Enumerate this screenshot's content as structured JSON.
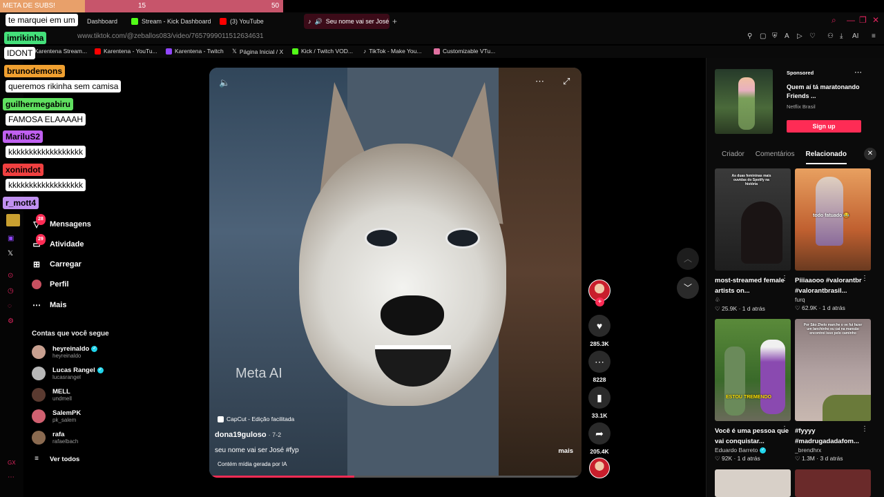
{
  "subgoal": {
    "label": "META DE SUBS!",
    "current": "15",
    "target": "50",
    "progress": 0.3
  },
  "tabs": [
    {
      "label": "Dashboard",
      "color": "#53fc18"
    },
    {
      "label": "Stream - Kick Dashboard",
      "color": "#53fc18"
    },
    {
      "label": "(3) YouTube",
      "color": "#ff0000"
    },
    {
      "label": "Seu nome vai ser José",
      "color": "#fe2c55"
    }
  ],
  "url": "www.tiktok.com/@zeballos083/video/7657999011512634631",
  "bookmarks": [
    {
      "label": "Karentena Stream..."
    },
    {
      "label": "Karentena - YouTu..."
    },
    {
      "label": "Karentena - Twitch"
    },
    {
      "label": "Página Inicial / X"
    },
    {
      "label": "Kick / Twitch VOD..."
    },
    {
      "label": "TikTok - Make You..."
    },
    {
      "label": "Customizable VTu..."
    }
  ],
  "chat": [
    {
      "user": "",
      "msg": "te marquei em um"
    },
    {
      "user": "imrikinha",
      "msg": "IDONT"
    },
    {
      "user": "brunodemons",
      "msg": "queremos rikinha sem camisa"
    },
    {
      "user": "guilhermegabiru",
      "msg": "FAMOSA ELAAAAH"
    },
    {
      "user": "MariluS2",
      "msg": "kkkkkkkkkkkkkkkkkk"
    },
    {
      "user": "xonindot",
      "msg": "kkkkkkkkkkkkkkkkkk"
    },
    {
      "user": "r_mott4",
      "msg": ""
    }
  ],
  "nav": {
    "messages": "Mensagens",
    "messages_badge": "28",
    "activity": "Atividade",
    "activity_badge": "29",
    "upload": "Carregar",
    "profile": "Perfil",
    "more": "Mais"
  },
  "following_title": "Contas que você segue",
  "following": [
    {
      "name": "heyreinaldo",
      "handle": "heyreinaldo",
      "verified": true
    },
    {
      "name": "Lucas Rangel",
      "handle": "lucasrangel",
      "verified": true
    },
    {
      "name": "MELL",
      "handle": "undmell",
      "verified": false
    },
    {
      "name": "SalemPK",
      "handle": "pk_salem",
      "verified": false
    },
    {
      "name": "rafa",
      "handle": "rafaelbach",
      "verified": false
    }
  ],
  "see_all": "Ver todos",
  "video": {
    "watermark": "Meta AI",
    "capcut": "CapCut - Edição facilitada",
    "author": "dona19guloso",
    "date": "· 7-2",
    "description": "seu nome vai ser José #fyp",
    "more": "mais",
    "ai_label": "Contém mídia gerada por IA",
    "progress": 0.39
  },
  "actions": {
    "likes": "285.3K",
    "comments": "8228",
    "saves": "33.1K",
    "shares": "205.4K"
  },
  "ad": {
    "sponsored": "Sponsored",
    "title": "Quem aí tá maratonando Friends ...",
    "brand": "Netflix Brasil",
    "cta": "Sign up"
  },
  "right_tabs": [
    "Criador",
    "Comentários",
    "Relacionado"
  ],
  "related": [
    {
      "title": "most-streamed female artists on...",
      "author": "",
      "likes": "25.9K",
      "age": "1 d atrás",
      "thumb_text": "As duas femininas mais ouvidas do Spotify na história"
    },
    {
      "title": "Piiiaaooo #valorantbr #valorantbrasil...",
      "author": "furq",
      "likes": "62.9K",
      "age": "1 d atrás",
      "thumb_text": "todo fatuado 😂"
    },
    {
      "title": "Você é uma pessoa que vai conquistar...",
      "author": "Eduardo Barreto",
      "likes": "92K",
      "age": "1 d atrás",
      "thumb_text": "ESTOU TREMENDO"
    },
    {
      "title": "#fyyyy #madrugadadafom...",
      "author": "_brendhrx",
      "likes": "1.3M",
      "age": "3 d atrás",
      "thumb_text": "Por São Zhelo marche o ve fui fazer um lanchinho eu cai na mansão encontrei isso pelo caminho"
    }
  ],
  "colors": {
    "accent": "#fe2c55",
    "background": "#000000"
  }
}
